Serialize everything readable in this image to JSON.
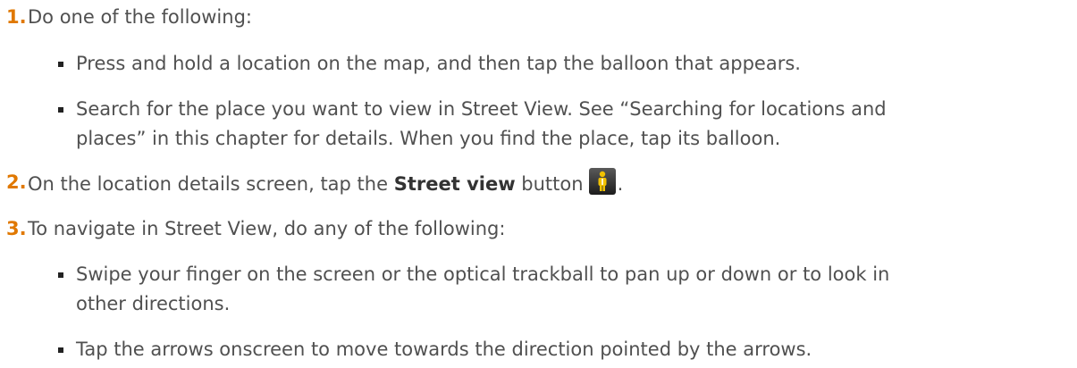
{
  "steps": [
    {
      "number": "1.",
      "text": "Do one of the following:",
      "bullets": [
        {
          "text": "Press and hold a location on the map, and then tap the balloon that appears."
        },
        {
          "line1": "Search for the place you want to view in Street View. See “Searching for locations and",
          "line2": "places” in this chapter for details. When you find the place, tap its balloon."
        }
      ]
    },
    {
      "number": "2.",
      "text_before": "On the location details screen, tap the",
      "bold": "Street view",
      "text_after": "button",
      "icon": "street-view-pegman-icon",
      "end": "."
    },
    {
      "number": "3.",
      "text": "To navigate in Street View, do any of the following:",
      "bullets": [
        {
          "line1": "Swipe your finger on the screen or the optical trackball to pan up or down or to look in",
          "line2": "other directions."
        },
        {
          "text": "Tap the arrows onscreen to move towards the direction pointed by the arrows."
        }
      ]
    }
  ],
  "colors": {
    "number": "#e07800",
    "text": "#505050",
    "bullet": "#222222"
  }
}
